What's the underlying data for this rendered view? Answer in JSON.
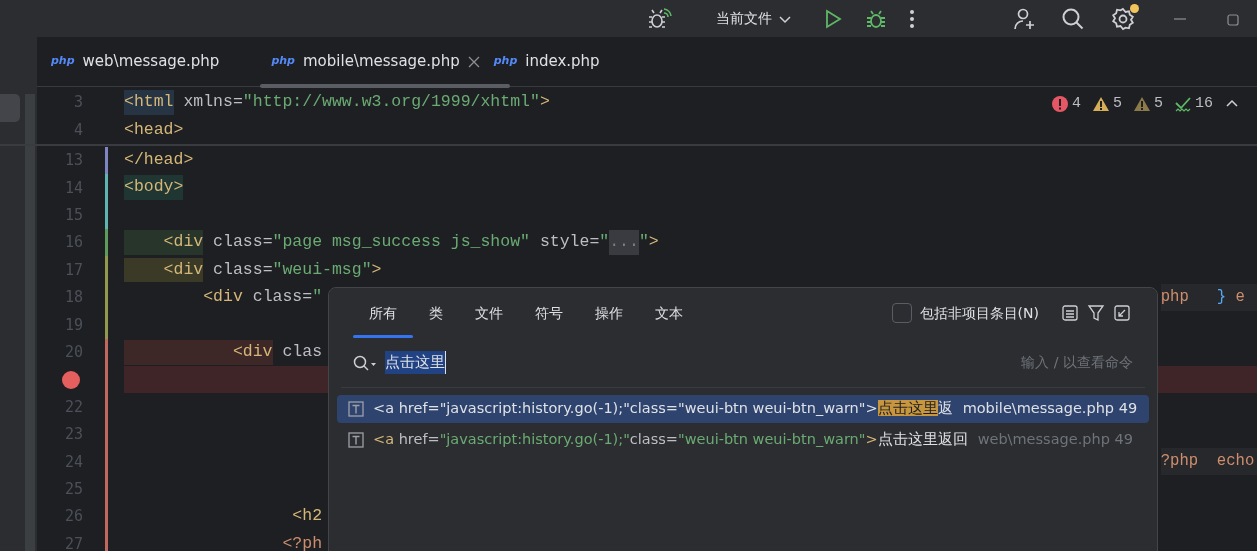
{
  "toolbar": {
    "run_config": {
      "label": "当前文件"
    },
    "settings_badge": true
  },
  "editor_tabs": [
    {
      "label": "web\\message.php",
      "icon": "php",
      "selected": false,
      "closable": false
    },
    {
      "label": "mobile\\message.php",
      "icon": "php",
      "selected": true,
      "closable": true
    },
    {
      "label": "index.php",
      "icon": "php",
      "selected": false,
      "closable": false
    }
  ],
  "inspections": [
    {
      "kind": "error",
      "count": "4"
    },
    {
      "kind": "warning",
      "count": "5"
    },
    {
      "kind": "weak",
      "count": "5"
    },
    {
      "kind": "typo",
      "count": "16"
    }
  ],
  "sticky_lines": [
    {
      "number": "3",
      "segments": [
        {
          "kind": "tag",
          "text": "<html",
          "color": "#263443"
        },
        {
          "kind": "attr",
          "text": " xmlns="
        },
        {
          "kind": "string",
          "text": "\"http://www.w3.org/1999/xhtml\""
        },
        {
          "kind": "tag",
          "text": ">"
        }
      ]
    },
    {
      "number": "4",
      "segments": [
        {
          "kind": "tag",
          "text": "<head>"
        }
      ]
    }
  ],
  "lines": [
    {
      "number": "13",
      "breakpoint": false,
      "color": "#7e84c4",
      "left": [
        {
          "kind": "tag",
          "text": "</head>"
        }
      ]
    },
    {
      "number": "14",
      "breakpoint": false,
      "color": "#5fb6b0",
      "left": [
        {
          "kind": "tag",
          "text": "<body>",
          "color": "#1f3633"
        }
      ]
    },
    {
      "number": "15",
      "breakpoint": false,
      "color": "#5fb6b0"
    },
    {
      "number": "16",
      "breakpoint": false,
      "color": "#5f9b5c",
      "left": [
        {
          "kind": "tag",
          "text": "    <div",
          "color": "#27352a"
        },
        {
          "kind": "attr",
          "text": " class="
        },
        {
          "kind": "string",
          "text": "\"page msg_success js_show\""
        },
        {
          "kind": "attr",
          "text": " style="
        },
        {
          "kind": "string",
          "text": "\""
        },
        {
          "kind": "fold",
          "text": "..."
        },
        {
          "kind": "string",
          "text": "\""
        },
        {
          "kind": "tag",
          "text": ">"
        }
      ]
    },
    {
      "number": "17",
      "breakpoint": false,
      "color": "#8f9a4e",
      "left": [
        {
          "kind": "tag",
          "text": "    <div",
          "color": "#3a3a26"
        },
        {
          "kind": "attr",
          "text": " class="
        },
        {
          "kind": "string",
          "text": "\"weui-msg\""
        },
        {
          "kind": "tag",
          "text": ">"
        }
      ]
    },
    {
      "number": "18",
      "breakpoint": false,
      "color": "#8f9a4e",
      "left": [
        {
          "kind": "tag",
          "text": "        <div"
        },
        {
          "kind": "attr",
          "text": " class="
        },
        {
          "kind": "string",
          "text": "\""
        }
      ],
      "right": [
        {
          "kind": "keyword",
          "text": "php"
        },
        {
          "kind": "brace",
          "text": "   }"
        },
        {
          "kind": "keyword",
          "text": " e"
        }
      ]
    },
    {
      "number": "19",
      "breakpoint": false,
      "color": "#8f9a4e"
    },
    {
      "number": "20",
      "breakpoint": false,
      "color": "#c0675f",
      "left": [
        {
          "kind": "tag",
          "text": "           <div",
          "color": "#3e2727"
        },
        {
          "kind": "attr",
          "text": " clas"
        }
      ]
    },
    {
      "breakpoint": true,
      "color": "#c0675f"
    },
    {
      "number": "22",
      "breakpoint": false,
      "color": "#c0675f"
    },
    {
      "number": "23",
      "breakpoint": false,
      "color": "#c0675f"
    },
    {
      "number": "24",
      "breakpoint": false,
      "color": "#c0675f",
      "right": [
        {
          "kind": "keyword",
          "text": "?php"
        },
        {
          "kind": "keyword",
          "text": "  echo"
        }
      ]
    },
    {
      "number": "25",
      "breakpoint": false,
      "color": "#c0675f"
    },
    {
      "number": "26",
      "breakpoint": false,
      "color": "#c0675f",
      "left": [
        {
          "kind": "tag",
          "text": "                 <h2"
        }
      ]
    },
    {
      "number": "27",
      "breakpoint": false,
      "color": "#c0675f",
      "left": [
        {
          "kind": "keyword",
          "text": "                <?ph"
        }
      ]
    }
  ],
  "search_popup": {
    "tabs": [
      {
        "label": "所有",
        "selected": true
      },
      {
        "label": "类",
        "selected": false
      },
      {
        "label": "文件",
        "selected": false
      },
      {
        "label": "符号",
        "selected": false
      },
      {
        "label": "操作",
        "selected": false
      },
      {
        "label": "文本",
        "selected": false
      }
    ],
    "include_non_project": {
      "label": "包括非项目条目(N)",
      "checked": false
    },
    "query": "点击这里",
    "hint": "输入 / 以查看命令",
    "results": [
      {
        "selected": true,
        "segments": [
          {
            "kind": "tag",
            "text": "<a"
          },
          {
            "kind": "attr",
            "text": " href="
          },
          {
            "kind": "string",
            "text": "\"javascript:history.go(-1);\""
          },
          {
            "kind": "attr",
            "text": "class="
          },
          {
            "kind": "string",
            "text": "\"weui-btn weui-btn_warn\""
          },
          {
            "kind": "tag",
            "text": ">"
          },
          {
            "kind": "match",
            "text": "点击这里"
          },
          {
            "kind": "text",
            "text": "返"
          }
        ],
        "location": "mobile\\message.php 49"
      },
      {
        "selected": false,
        "segments": [
          {
            "kind": "tag",
            "text": "<a"
          },
          {
            "kind": "attr",
            "text": " href="
          },
          {
            "kind": "string",
            "text": "\"javascript:history.go(-1);\""
          },
          {
            "kind": "attr",
            "text": "class="
          },
          {
            "kind": "string",
            "text": "\"weui-btn weui-btn_warn\""
          },
          {
            "kind": "tag",
            "text": ">"
          },
          {
            "kind": "text",
            "text": "点击这里返回"
          }
        ],
        "location": "web\\message.php 49"
      }
    ]
  }
}
